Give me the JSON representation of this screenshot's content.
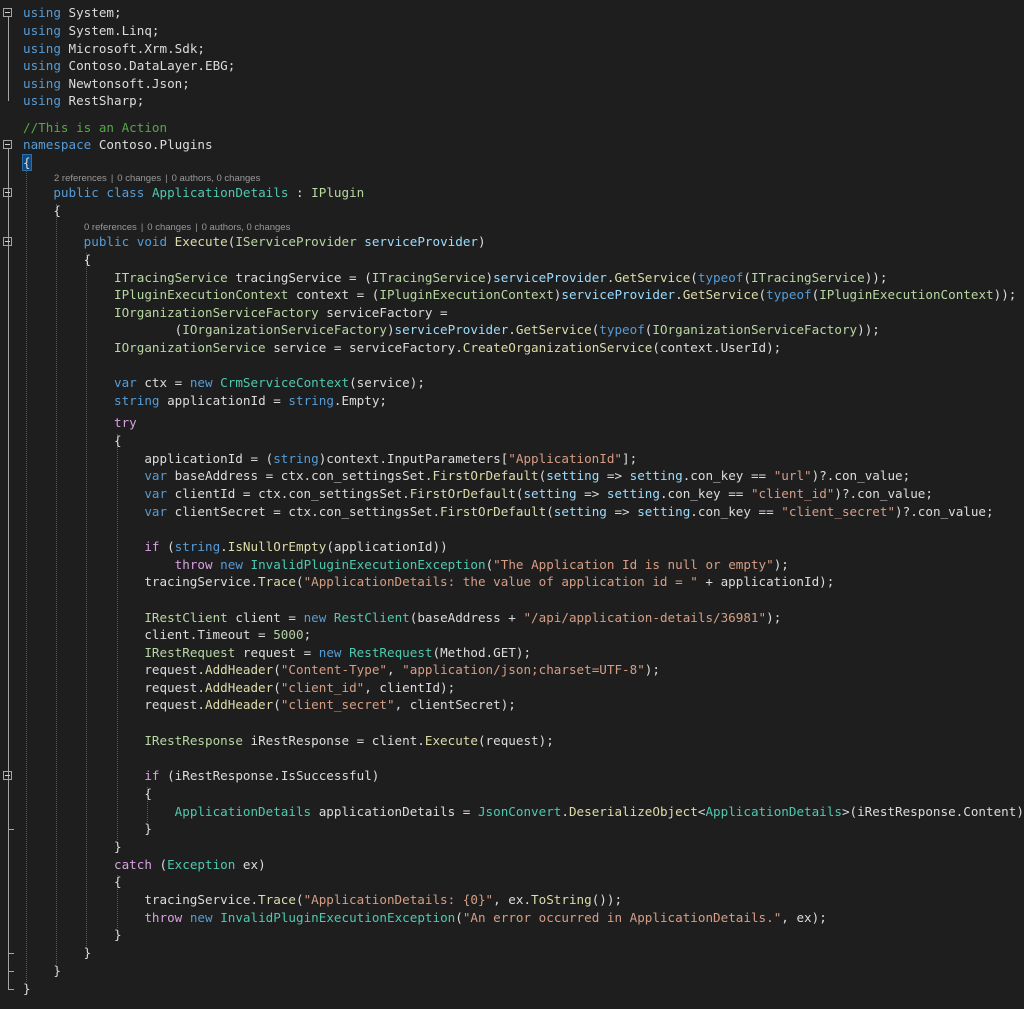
{
  "editor": {
    "colors": {
      "background": "#1e1e1e",
      "keyword": "#569cd6",
      "control_keyword": "#d8a0df",
      "type": "#4ec9b0",
      "interface": "#b8d7a3",
      "method": "#dcdcaa",
      "parameter": "#9cdcfe",
      "string": "#d69d85",
      "number": "#b5cea8",
      "comment": "#57a64a",
      "plain": "#dcdcdc"
    },
    "code_lens": {
      "class": {
        "references": "2 references",
        "changes": "0 changes",
        "authors": "0 authors, 0 changes",
        "separator": "|"
      },
      "method": {
        "references": "0 references",
        "changes": "0 changes",
        "authors": "0 authors, 0 changes",
        "separator": "|"
      }
    },
    "lines": [
      [
        [
          "k",
          "using"
        ],
        [
          "d",
          " System;"
        ]
      ],
      [
        [
          "k",
          "using"
        ],
        [
          "d",
          " System.Linq;"
        ]
      ],
      [
        [
          "k",
          "using"
        ],
        [
          "d",
          " Microsoft.Xrm.Sdk;"
        ]
      ],
      [
        [
          "k",
          "using"
        ],
        [
          "d",
          " Contoso.DataLayer.EBG;"
        ]
      ],
      [
        [
          "k",
          "using"
        ],
        [
          "d",
          " Newtonsoft.Json;"
        ]
      ],
      [
        [
          "k",
          "using"
        ],
        [
          "d",
          " RestSharp;"
        ]
      ],
      [
        [
          "c",
          "//This is an Action"
        ]
      ],
      [
        [
          "k",
          "namespace"
        ],
        [
          "d",
          " Contoso.Plugins"
        ]
      ],
      [
        [
          "d",
          "{"
        ]
      ],
      [
        [
          "d",
          "    "
        ],
        [
          "k",
          "public class"
        ],
        [
          "d",
          " "
        ],
        [
          "t",
          "ApplicationDetails"
        ],
        [
          "d",
          " : "
        ],
        [
          "i",
          "IPlugin"
        ]
      ],
      [
        [
          "d",
          "    {"
        ]
      ],
      [
        [
          "d",
          "        "
        ],
        [
          "k",
          "public void"
        ],
        [
          "d",
          " "
        ],
        [
          "m",
          "Execute"
        ],
        [
          "d",
          "("
        ],
        [
          "i",
          "IServiceProvider"
        ],
        [
          "d",
          " "
        ],
        [
          "p",
          "serviceProvider"
        ],
        [
          "d",
          ")"
        ]
      ],
      [
        [
          "d",
          "        {"
        ]
      ],
      [
        [
          "d",
          "            "
        ],
        [
          "i",
          "ITracingService"
        ],
        [
          "d",
          " tracingService = ("
        ],
        [
          "i",
          "ITracingService"
        ],
        [
          "d",
          ")"
        ],
        [
          "p",
          "serviceProvider"
        ],
        [
          "d",
          "."
        ],
        [
          "m",
          "GetService"
        ],
        [
          "d",
          "("
        ],
        [
          "k",
          "typeof"
        ],
        [
          "d",
          "("
        ],
        [
          "i",
          "ITracingService"
        ],
        [
          "d",
          "));"
        ]
      ],
      [
        [
          "d",
          "            "
        ],
        [
          "i",
          "IPluginExecutionContext"
        ],
        [
          "d",
          " context = ("
        ],
        [
          "i",
          "IPluginExecutionContext"
        ],
        [
          "d",
          ")"
        ],
        [
          "p",
          "serviceProvider"
        ],
        [
          "d",
          "."
        ],
        [
          "m",
          "GetService"
        ],
        [
          "d",
          "("
        ],
        [
          "k",
          "typeof"
        ],
        [
          "d",
          "("
        ],
        [
          "i",
          "IPluginExecutionContext"
        ],
        [
          "d",
          "));"
        ]
      ],
      [
        [
          "d",
          "            "
        ],
        [
          "i",
          "IOrganizationServiceFactory"
        ],
        [
          "d",
          " serviceFactory ="
        ]
      ],
      [
        [
          "d",
          "                    ("
        ],
        [
          "i",
          "IOrganizationServiceFactory"
        ],
        [
          "d",
          ")"
        ],
        [
          "p",
          "serviceProvider"
        ],
        [
          "d",
          "."
        ],
        [
          "m",
          "GetService"
        ],
        [
          "d",
          "("
        ],
        [
          "k",
          "typeof"
        ],
        [
          "d",
          "("
        ],
        [
          "i",
          "IOrganizationServiceFactory"
        ],
        [
          "d",
          "));"
        ]
      ],
      [
        [
          "d",
          "            "
        ],
        [
          "i",
          "IOrganizationService"
        ],
        [
          "d",
          " service = serviceFactory."
        ],
        [
          "m",
          "CreateOrganizationService"
        ],
        [
          "d",
          "(context.UserId);"
        ]
      ],
      [],
      [
        [
          "d",
          "            "
        ],
        [
          "k",
          "var"
        ],
        [
          "d",
          " ctx = "
        ],
        [
          "k",
          "new"
        ],
        [
          "d",
          " "
        ],
        [
          "t",
          "CrmServiceContext"
        ],
        [
          "d",
          "(service);"
        ]
      ],
      [
        [
          "d",
          "            "
        ],
        [
          "k",
          "string"
        ],
        [
          "d",
          " applicationId = "
        ],
        [
          "k",
          "string"
        ],
        [
          "d",
          ".Empty;"
        ]
      ],
      [
        [
          "d",
          "            "
        ],
        [
          "ctl",
          "try"
        ]
      ],
      [
        [
          "d",
          "            {"
        ]
      ],
      [
        [
          "d",
          "                applicationId = ("
        ],
        [
          "k",
          "string"
        ],
        [
          "d",
          ")context.InputParameters["
        ],
        [
          "s",
          "\"ApplicationId\""
        ],
        [
          "d",
          "];"
        ]
      ],
      [
        [
          "d",
          "                "
        ],
        [
          "k",
          "var"
        ],
        [
          "d",
          " baseAddress = ctx.con_settingsSet."
        ],
        [
          "m",
          "FirstOrDefault"
        ],
        [
          "d",
          "("
        ],
        [
          "p",
          "setting"
        ],
        [
          "d",
          " => "
        ],
        [
          "p",
          "setting"
        ],
        [
          "d",
          ".con_key == "
        ],
        [
          "s",
          "\"url\""
        ],
        [
          "d",
          ")?.con_value;"
        ]
      ],
      [
        [
          "d",
          "                "
        ],
        [
          "k",
          "var"
        ],
        [
          "d",
          " clientId = ctx.con_settingsSet."
        ],
        [
          "m",
          "FirstOrDefault"
        ],
        [
          "d",
          "("
        ],
        [
          "p",
          "setting"
        ],
        [
          "d",
          " => "
        ],
        [
          "p",
          "setting"
        ],
        [
          "d",
          ".con_key == "
        ],
        [
          "s",
          "\"client_id\""
        ],
        [
          "d",
          ")?.con_value;"
        ]
      ],
      [
        [
          "d",
          "                "
        ],
        [
          "k",
          "var"
        ],
        [
          "d",
          " clientSecret = ctx.con_settingsSet."
        ],
        [
          "m",
          "FirstOrDefault"
        ],
        [
          "d",
          "("
        ],
        [
          "p",
          "setting"
        ],
        [
          "d",
          " => "
        ],
        [
          "p",
          "setting"
        ],
        [
          "d",
          ".con_key == "
        ],
        [
          "s",
          "\"client_secret\""
        ],
        [
          "d",
          ")?.con_value;"
        ]
      ],
      [],
      [
        [
          "d",
          "                "
        ],
        [
          "ctl",
          "if"
        ],
        [
          "d",
          " ("
        ],
        [
          "k",
          "string"
        ],
        [
          "d",
          "."
        ],
        [
          "m",
          "IsNullOrEmpty"
        ],
        [
          "d",
          "(applicationId))"
        ]
      ],
      [
        [
          "d",
          "                    "
        ],
        [
          "ctl",
          "throw"
        ],
        [
          "d",
          " "
        ],
        [
          "k",
          "new"
        ],
        [
          "d",
          " "
        ],
        [
          "t",
          "InvalidPluginExecutionException"
        ],
        [
          "d",
          "("
        ],
        [
          "s",
          "\"The Application Id is null or empty\""
        ],
        [
          "d",
          ");"
        ]
      ],
      [
        [
          "d",
          "                tracingService."
        ],
        [
          "m",
          "Trace"
        ],
        [
          "d",
          "("
        ],
        [
          "s",
          "\"ApplicationDetails: the value of application id = \""
        ],
        [
          "d",
          " + applicationId);"
        ]
      ],
      [],
      [
        [
          "d",
          "                "
        ],
        [
          "i",
          "IRestClient"
        ],
        [
          "d",
          " client = "
        ],
        [
          "k",
          "new"
        ],
        [
          "d",
          " "
        ],
        [
          "t",
          "RestClient"
        ],
        [
          "d",
          "(baseAddress + "
        ],
        [
          "s",
          "\"/api/application-details/36981\""
        ],
        [
          "d",
          ");"
        ]
      ],
      [
        [
          "d",
          "                client.Timeout = "
        ],
        [
          "n",
          "5000"
        ],
        [
          "d",
          ";"
        ]
      ],
      [
        [
          "d",
          "                "
        ],
        [
          "i",
          "IRestRequest"
        ],
        [
          "d",
          " request = "
        ],
        [
          "k",
          "new"
        ],
        [
          "d",
          " "
        ],
        [
          "t",
          "RestRequest"
        ],
        [
          "d",
          "(Method.GET);"
        ]
      ],
      [
        [
          "d",
          "                request."
        ],
        [
          "m",
          "AddHeader"
        ],
        [
          "d",
          "("
        ],
        [
          "s",
          "\"Content-Type\""
        ],
        [
          "d",
          ", "
        ],
        [
          "s",
          "\"application/json;charset=UTF-8\""
        ],
        [
          "d",
          ");"
        ]
      ],
      [
        [
          "d",
          "                request."
        ],
        [
          "m",
          "AddHeader"
        ],
        [
          "d",
          "("
        ],
        [
          "s",
          "\"client_id\""
        ],
        [
          "d",
          ", clientId);"
        ]
      ],
      [
        [
          "d",
          "                request."
        ],
        [
          "m",
          "AddHeader"
        ],
        [
          "d",
          "("
        ],
        [
          "s",
          "\"client_secret\""
        ],
        [
          "d",
          ", clientSecret);"
        ]
      ],
      [],
      [
        [
          "d",
          "                "
        ],
        [
          "i",
          "IRestResponse"
        ],
        [
          "d",
          " iRestResponse = client."
        ],
        [
          "m",
          "Execute"
        ],
        [
          "d",
          "(request);"
        ]
      ],
      [],
      [
        [
          "d",
          "                "
        ],
        [
          "ctl",
          "if"
        ],
        [
          "d",
          " (iRestResponse.IsSuccessful)"
        ]
      ],
      [
        [
          "d",
          "                {"
        ]
      ],
      [
        [
          "d",
          "                    "
        ],
        [
          "t",
          "ApplicationDetails"
        ],
        [
          "d",
          " applicationDetails = "
        ],
        [
          "t",
          "JsonConvert"
        ],
        [
          "d",
          "."
        ],
        [
          "m",
          "DeserializeObject"
        ],
        [
          "d",
          "<"
        ],
        [
          "t",
          "ApplicationDetails"
        ],
        [
          "d",
          ">(iRestResponse.Content);"
        ]
      ],
      [
        [
          "d",
          "                }"
        ]
      ],
      [
        [
          "d",
          "            }"
        ]
      ],
      [
        [
          "d",
          "            "
        ],
        [
          "ctl",
          "catch"
        ],
        [
          "d",
          " ("
        ],
        [
          "t",
          "Exception"
        ],
        [
          "d",
          " ex)"
        ]
      ],
      [
        [
          "d",
          "            {"
        ]
      ],
      [
        [
          "d",
          "                tracingService."
        ],
        [
          "m",
          "Trace"
        ],
        [
          "d",
          "("
        ],
        [
          "s",
          "\"ApplicationDetails: {0}\""
        ],
        [
          "d",
          ", ex."
        ],
        [
          "m",
          "ToString"
        ],
        [
          "d",
          "());"
        ]
      ],
      [
        [
          "d",
          "                "
        ],
        [
          "ctl",
          "throw"
        ],
        [
          "d",
          " "
        ],
        [
          "k",
          "new"
        ],
        [
          "d",
          " "
        ],
        [
          "t",
          "InvalidPluginExecutionException"
        ],
        [
          "d",
          "("
        ],
        [
          "s",
          "\"An error occurred in ApplicationDetails.\""
        ],
        [
          "d",
          ", ex);"
        ]
      ],
      [
        [
          "d",
          "            }"
        ]
      ],
      [
        [
          "d",
          "        }"
        ]
      ],
      [
        [
          "d",
          "    }"
        ]
      ],
      [
        [
          "d",
          "}"
        ]
      ]
    ]
  }
}
